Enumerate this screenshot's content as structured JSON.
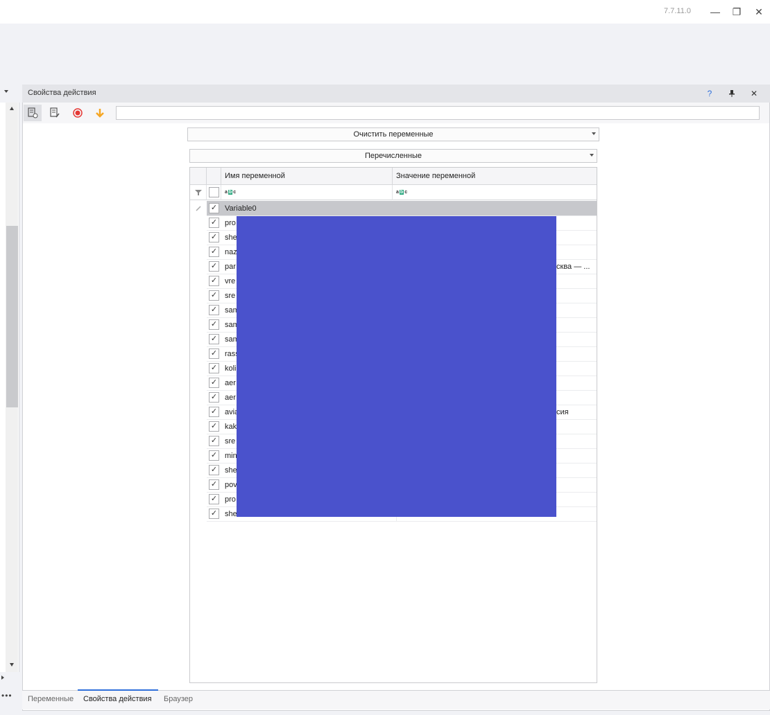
{
  "window": {
    "version": "7.7.11.0",
    "minimize_glyph": "—",
    "restore_glyph": "❐",
    "close_glyph": "✕"
  },
  "panel": {
    "title": "Свойства действия",
    "help_glyph": "?",
    "pin_glyph": "⊥",
    "close_glyph": "✕"
  },
  "toolbar": {
    "icons": [
      "properties-icon",
      "edit-notes-icon",
      "record-icon",
      "download-arrow-icon"
    ],
    "search_value": ""
  },
  "action_combo": {
    "value": "Очистить переменные"
  },
  "mode_combo": {
    "value": "Перечисленные"
  },
  "grid": {
    "columns": {
      "name": "Имя переменной",
      "value": "Значение переменной"
    },
    "filter_glyph": "abc",
    "rows": [
      {
        "name": "Variable0",
        "value": "",
        "checked": true,
        "selected": true
      },
      {
        "name": "pro",
        "value": "",
        "checked": true
      },
      {
        "name": "she",
        "value": "",
        "checked": true
      },
      {
        "name": "naz",
        "value": "",
        "checked": true
      },
      {
        "name": "par",
        "value": "сква — ...",
        "checked": true
      },
      {
        "name": "vre",
        "value": "",
        "checked": true
      },
      {
        "name": "sre",
        "value": "",
        "checked": true
      },
      {
        "name": "sam",
        "value": "",
        "checked": true
      },
      {
        "name": "sam",
        "value": "",
        "checked": true
      },
      {
        "name": "sam",
        "value": "",
        "checked": true
      },
      {
        "name": "rass",
        "value": "",
        "checked": true
      },
      {
        "name": "kolic",
        "value": "",
        "checked": true
      },
      {
        "name": "aer",
        "value": "",
        "checked": true
      },
      {
        "name": "aer",
        "value": "",
        "checked": true
      },
      {
        "name": "avia",
        "value": "сия",
        "checked": true
      },
      {
        "name": "kak",
        "value": "",
        "checked": true
      },
      {
        "name": "sre",
        "value": "",
        "checked": true
      },
      {
        "name": "min",
        "value": "",
        "checked": true
      },
      {
        "name": "she",
        "value": "",
        "checked": true
      },
      {
        "name": "pov",
        "value": "",
        "checked": true
      },
      {
        "name": "pro",
        "value": "",
        "checked": true
      },
      {
        "name": "she",
        "value": "",
        "checked": true
      }
    ]
  },
  "bottom_tabs": [
    "Переменные",
    "Свойства действия",
    "Браузер"
  ],
  "active_tab": 1,
  "colors": {
    "accent": "#2f6fdb",
    "overlay": "#4a52cc",
    "record": "#e53935",
    "download": "#f5a623"
  }
}
